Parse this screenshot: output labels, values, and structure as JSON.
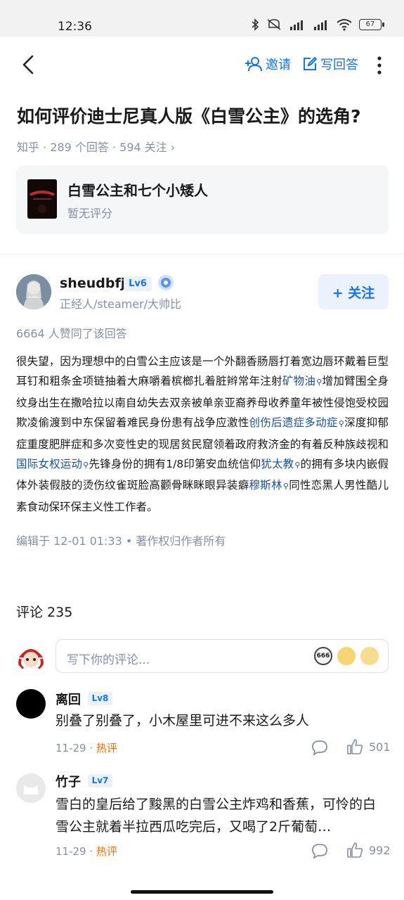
{
  "status_bar": {
    "time": "12:36",
    "battery": "67"
  },
  "nav": {
    "invite_label": "邀请",
    "write_answer_label": "写回答"
  },
  "question": {
    "title": "如何评价迪士尼真人版《白雪公主》的选角?",
    "meta": "知乎 · 289 个回答 · 594 关注 ›"
  },
  "related_card": {
    "title": "白雪公主和七个小矮人",
    "subtitle": "暂无评分"
  },
  "author": {
    "name": "sheudbfj",
    "level": "Lv6",
    "bio": "正经人/steamer/大帅比",
    "follow_label": "+ 关注"
  },
  "answer": {
    "likes": "6664 人赞同了该回答",
    "segments": [
      "很失望，因为理想中的白雪公主应该是一个外翻香肠唇打着宽边唇环戴着巨型耳钉和粗条金项链抽着大麻嚼着槟榔扎着脏辫常年注射",
      "矿物油",
      "增加臂围全身纹身出生在撒哈拉以南自幼失去双亲被单亲亚裔养母收养童年被性侵饱受校园欺凌偷渡到中东保留着难民身份患有战争应激性",
      "创伤后遗症多动症",
      "深度抑郁症重度肥胖症和多次变性史的现居贫民窟领着政府救济金的有着反种族歧视和",
      "国际女权运动",
      "先锋身份的拥有1/8印第安血统信仰",
      "犹太教",
      "的拥有多块内嵌假体外装假肢的烫伤纹雀斑脸高颧骨眯眯眼异装癖",
      "穆斯林",
      "同性恋黑人男性酷儿素食动保环保主义性工作者。"
    ],
    "edited": "编辑于 12-01 01:33 • 著作权归作者所有"
  },
  "comments_section": {
    "title": "评论 235",
    "input_placeholder": "写下你的评论...",
    "emoji_666": "666",
    "comments": [
      {
        "name": "离回",
        "level": "Lv8",
        "text": "别叠了别叠了，小木屋里可进不来这么多人",
        "date": "11-29 · ",
        "hot": "热评",
        "likes": "501"
      },
      {
        "name": "竹子",
        "level": "Lv7",
        "text": "雪白的皇后给了黢黑的白雪公主炸鸡和香蕉，可怜的白雪公主就着半拉西瓜吃完后，又喝了2斤葡萄…",
        "date": "11-29 · ",
        "hot": "热评",
        "likes": "992"
      }
    ]
  },
  "colors": {
    "accent": "#1772f6",
    "secondary_text": "#8590a6",
    "hot": "#ff6c00"
  }
}
